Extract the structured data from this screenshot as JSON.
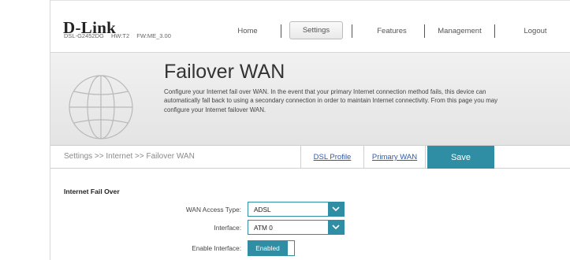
{
  "header": {
    "brand": "D-Link",
    "model": "DSL-G2452DG",
    "hw": "HW:T2",
    "fw": "FW:ME_3.00",
    "nav": {
      "home": "Home",
      "settings": "Settings",
      "features": "Features",
      "management": "Management",
      "logout": "Logout"
    },
    "active_nav": "settings"
  },
  "banner": {
    "title": "Failover WAN",
    "description": "Configure your Internet fail over WAN. In the event that your primary Internet connection method fails, this device can automatically fall back to using a secondary connection in order to maintain Internet connectivity. From this page you may configure your Internet failover WAN.",
    "icon": "globe-icon"
  },
  "breadcrumb": {
    "text": "Settings >> Internet >> Failover WAN",
    "tabs": [
      "DSL Profile",
      "Primary WAN"
    ],
    "save_label": "Save"
  },
  "form": {
    "section_title": "Internet Fail Over",
    "wan_access_type": {
      "label": "WAN Access Type:",
      "value": "ADSL"
    },
    "interface": {
      "label": "Interface:",
      "value": "ATM 0"
    },
    "enable_interface": {
      "label": "Enable Interface:",
      "value": "Enabled",
      "state": true
    }
  },
  "colors": {
    "accent": "#2f8ea3",
    "link": "#2a5bb5"
  }
}
